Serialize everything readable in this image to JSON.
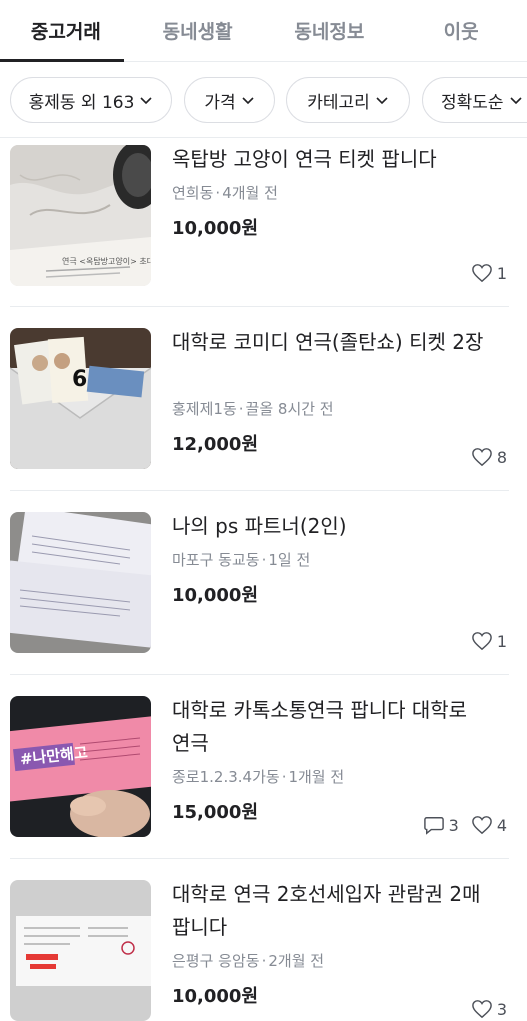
{
  "tabs": [
    {
      "label": "중고거래",
      "active": true
    },
    {
      "label": "동네생활",
      "active": false
    },
    {
      "label": "동네정보",
      "active": false
    },
    {
      "label": "이웃",
      "active": false
    }
  ],
  "filters": [
    {
      "label": "홍제동 외 163"
    },
    {
      "label": "가격"
    },
    {
      "label": "카테고리"
    },
    {
      "label": "정확도순"
    }
  ],
  "items": [
    {
      "title": "옥탑방 고양이 연극 티켓 팝니다",
      "location": "연희동",
      "time": "4개월 전",
      "price": "10,000원",
      "likes": "1",
      "chats": null
    },
    {
      "title": "대학로 코미디 연극(졸탄쇼) 티켓 2장",
      "location": "홍제제1동",
      "time": "끌올 8시간 전",
      "price": "12,000원",
      "likes": "8",
      "chats": null
    },
    {
      "title": "나의 ps 파트너(2인)",
      "location": "마포구 동교동",
      "time": "1일 전",
      "price": "10,000원",
      "likes": "1",
      "chats": null
    },
    {
      "title": "대학로 카톡소통연극 팝니다 대학로 연극",
      "location": "종로1.2.3.4가동",
      "time": "1개월 전",
      "price": "15,000원",
      "likes": "4",
      "chats": "3"
    },
    {
      "title": "대학로 연극 2호선세입자 관람권 2매 팝니다",
      "location": "은평구 응암동",
      "time": "2개월 전",
      "price": "10,000원",
      "likes": "3",
      "chats": null
    }
  ],
  "thumb_text": {
    "item1": "연극 <옥탑방고양이> 초대권",
    "item4": "#나만해고"
  },
  "icons": {
    "chevron": "chevron-down-icon",
    "heart": "heart-icon",
    "chat": "chat-bubble-icon"
  },
  "colors": {
    "text": "#212124",
    "muted": "#868b94",
    "border": "#dcdee3",
    "divider": "#e9ecef"
  }
}
